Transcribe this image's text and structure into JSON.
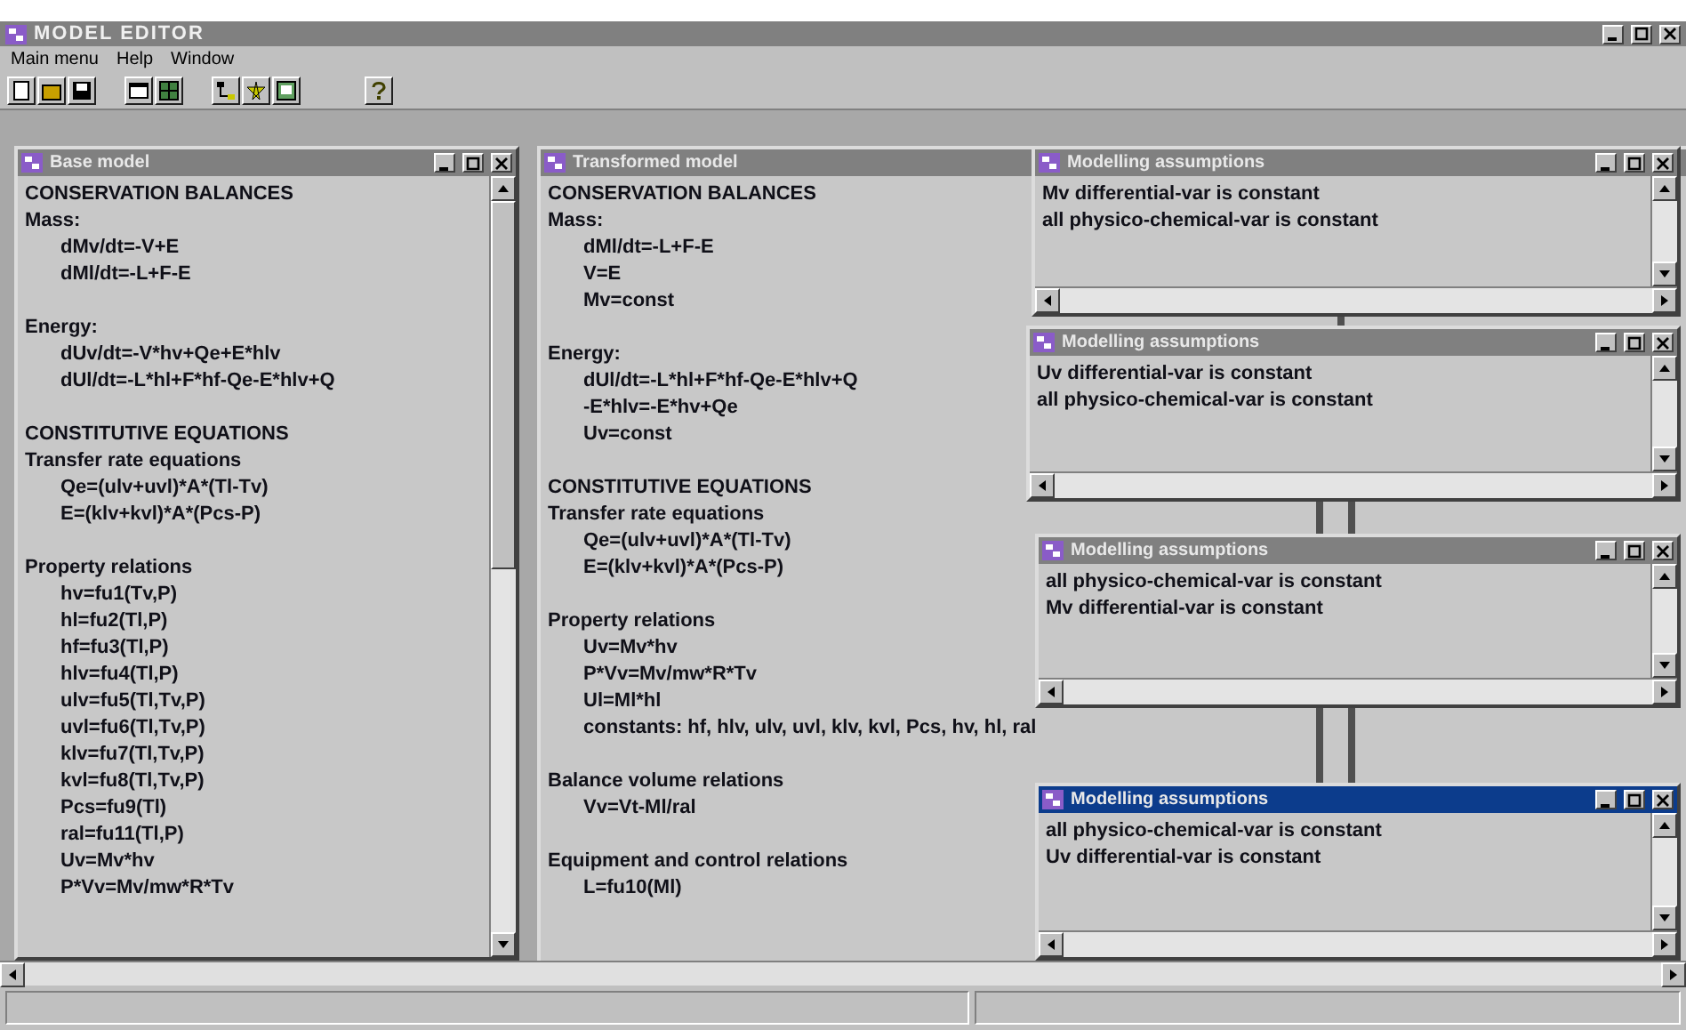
{
  "window": {
    "title": "MODEL EDITOR"
  },
  "menu": [
    {
      "label": "Main menu"
    },
    {
      "label": "Help"
    },
    {
      "label": "Window"
    }
  ],
  "base_model": {
    "title": "Base model",
    "lines": [
      {
        "kind": "heading",
        "text": "CONSERVATION BALANCES"
      },
      {
        "kind": "label",
        "text": "Mass:"
      },
      {
        "kind": "eq",
        "text": "dMv/dt=-V+E"
      },
      {
        "kind": "eq",
        "text": "dMl/dt=-L+F-E"
      },
      {
        "kind": "gap"
      },
      {
        "kind": "label",
        "text": "Energy:"
      },
      {
        "kind": "eq",
        "text": "dUv/dt=-V*hv+Qe+E*hlv"
      },
      {
        "kind": "eq",
        "text": "dUl/dt=-L*hl+F*hf-Qe-E*hlv+Q"
      },
      {
        "kind": "gap"
      },
      {
        "kind": "heading",
        "text": "CONSTITUTIVE EQUATIONS"
      },
      {
        "kind": "label",
        "text": "Transfer rate equations"
      },
      {
        "kind": "eq",
        "text": "Qe=(ulv+uvl)*A*(Tl-Tv)"
      },
      {
        "kind": "eq",
        "text": "E=(klv+kvl)*A*(Pcs-P)"
      },
      {
        "kind": "gap"
      },
      {
        "kind": "label",
        "text": "Property relations"
      },
      {
        "kind": "eq",
        "text": "hv=fu1(Tv,P)"
      },
      {
        "kind": "eq",
        "text": "hl=fu2(Tl,P)"
      },
      {
        "kind": "eq",
        "text": "hf=fu3(Tl,P)"
      },
      {
        "kind": "eq",
        "text": "hlv=fu4(Tl,P)"
      },
      {
        "kind": "eq",
        "text": "ulv=fu5(Tl,Tv,P)"
      },
      {
        "kind": "eq",
        "text": "uvl=fu6(Tl,Tv,P)"
      },
      {
        "kind": "eq",
        "text": "klv=fu7(Tl,Tv,P)"
      },
      {
        "kind": "eq",
        "text": "kvl=fu8(Tl,Tv,P)"
      },
      {
        "kind": "eq",
        "text": "Pcs=fu9(Tl)"
      },
      {
        "kind": "eq",
        "text": "ral=fu11(Tl,P)"
      },
      {
        "kind": "eq",
        "text": "Uv=Mv*hv"
      },
      {
        "kind": "eq",
        "text": "P*Vv=Mv/mw*R*Tv"
      }
    ]
  },
  "transformed_model": {
    "title": "Transformed model",
    "lines": [
      {
        "kind": "heading",
        "text": "CONSERVATION BALANCES"
      },
      {
        "kind": "label",
        "text": "Mass:"
      },
      {
        "kind": "eq",
        "text": "dMl/dt=-L+F-E"
      },
      {
        "kind": "eq",
        "text": "V=E"
      },
      {
        "kind": "eq",
        "text": "Mv=const"
      },
      {
        "kind": "gap"
      },
      {
        "kind": "label",
        "text": "Energy:"
      },
      {
        "kind": "eq",
        "text": "dUl/dt=-L*hl+F*hf-Qe-E*hlv+Q"
      },
      {
        "kind": "eq",
        "text": "-E*hlv=-E*hv+Qe"
      },
      {
        "kind": "eq",
        "text": "Uv=const"
      },
      {
        "kind": "gap"
      },
      {
        "kind": "heading",
        "text": "CONSTITUTIVE EQUATIONS"
      },
      {
        "kind": "label",
        "text": "Transfer rate equations"
      },
      {
        "kind": "eq",
        "text": "Qe=(ulv+uvl)*A*(Tl-Tv)"
      },
      {
        "kind": "eq",
        "text": "E=(klv+kvl)*A*(Pcs-P)"
      },
      {
        "kind": "gap"
      },
      {
        "kind": "label",
        "text": "Property relations"
      },
      {
        "kind": "eq",
        "text": "Uv=Mv*hv"
      },
      {
        "kind": "eq",
        "text": "P*Vv=Mv/mw*R*Tv"
      },
      {
        "kind": "eq",
        "text": "Ul=Ml*hl"
      },
      {
        "kind": "eq",
        "text": "constants: hf, hlv, ulv, uvl, klv, kvl, Pcs, hv, hl, ral"
      },
      {
        "kind": "gap"
      },
      {
        "kind": "label",
        "text": "Balance volume relations"
      },
      {
        "kind": "eq",
        "text": "Vv=Vt-Ml/ral"
      },
      {
        "kind": "gap"
      },
      {
        "kind": "label",
        "text": "Equipment and control relations"
      },
      {
        "kind": "eq",
        "text": "L=fu10(Ml)"
      }
    ]
  },
  "assumption_windows": [
    {
      "title": "Modelling assumptions",
      "selected": false,
      "lines": [
        "Mv differential-var is constant",
        "all physico-chemical-var is constant"
      ]
    },
    {
      "title": "Modelling assumptions",
      "selected": false,
      "lines": [
        "Uv differential-var is constant",
        "all physico-chemical-var is constant"
      ]
    },
    {
      "title": "Modelling assumptions",
      "selected": false,
      "lines": [
        "all physico-chemical-var is constant",
        "Mv differential-var is constant"
      ]
    },
    {
      "title": "Modelling assumptions",
      "selected": true,
      "lines": [
        "all physico-chemical-var is constant",
        "Uv differential-var is constant"
      ]
    }
  ]
}
